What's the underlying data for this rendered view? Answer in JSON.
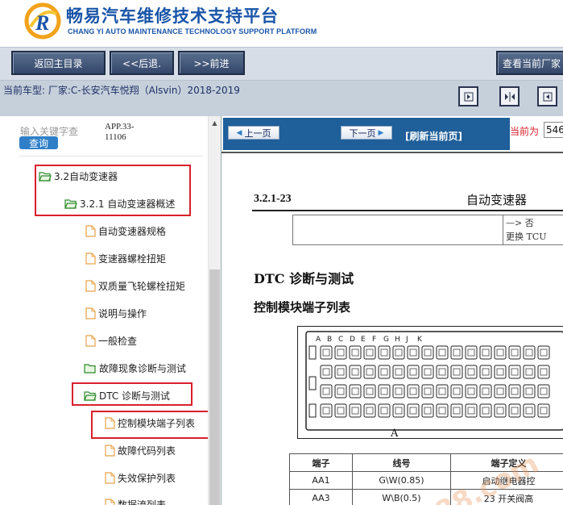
{
  "header": {
    "title_cn": "畅易汽车维修技术支持平台",
    "title_en": "CHANG YI AUTO MAINTENANCE TECHNOLOGY SUPPORT PLATFORM",
    "logo_letter": "R",
    "brand_color": "#1a55a8"
  },
  "nav": {
    "home": "返回主目录",
    "back": "<<后退.",
    "forward": ">>前进",
    "view_current": "查看当前厂家"
  },
  "car_info": {
    "label": "当前车型:  厂家:C-长安汽车悦翔（Alsvin）2018-2019"
  },
  "sidebar": {
    "search_placeholder": "输入关键字查",
    "search_button": "查询",
    "app_id": "APP.33-11106",
    "tree": [
      {
        "label": "3.2自动变速器",
        "type": "folder"
      },
      {
        "label": "3.2.1 自动变速器概述",
        "type": "folder"
      },
      {
        "label": "自动变速器规格",
        "type": "page"
      },
      {
        "label": "变速器螺栓扭矩",
        "type": "page"
      },
      {
        "label": "双质量飞轮螺栓扭矩",
        "type": "page"
      },
      {
        "label": "说明与操作",
        "type": "page"
      },
      {
        "label": "一般检查",
        "type": "page"
      },
      {
        "label": "故障现象诊断与测试",
        "type": "folder"
      },
      {
        "label": "DTC 诊断与测试",
        "type": "folder"
      },
      {
        "label": "控制模块端子列表",
        "type": "page"
      },
      {
        "label": "故障代码列表",
        "type": "page"
      },
      {
        "label": "失效保护列表",
        "type": "page"
      },
      {
        "label": "数据流列表",
        "type": "page"
      }
    ],
    "highlight_color": "#d9202b"
  },
  "doc_toolbar": {
    "prev_page": "上一页",
    "next_page": "下一页",
    "refresh": "[刷新当前页]",
    "current_label": "当前为",
    "current_page": "546"
  },
  "document": {
    "page_number": "3.2.1-23",
    "chapter": "自动变速器",
    "table_cell_1": "—> 否",
    "table_cell_2": "更换 TCU",
    "section_title": "DTC 诊断与测试",
    "subsection_title": "控制模块端子列表",
    "connector_caption": "A",
    "connector_letters": [
      "A",
      "B",
      "C",
      "D",
      "E",
      "F",
      "G",
      "H",
      "J",
      "K"
    ],
    "pins_table": {
      "headers": [
        "端子",
        "线号",
        "端子定义"
      ],
      "rows": [
        [
          "AA1",
          "G\\W(0.85)",
          "启动继电器控"
        ],
        [
          "AA3",
          "W\\B(0.5)",
          "23 开关阀高"
        ]
      ]
    }
  },
  "watermark": "88.com"
}
